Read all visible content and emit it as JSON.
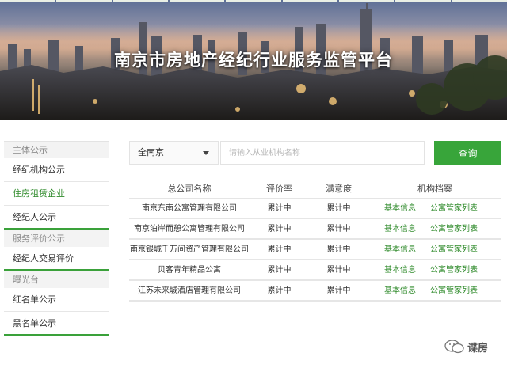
{
  "hero": {
    "title": "南京市房地产经纪行业服务监管平台"
  },
  "sidebar": {
    "groups": [
      {
        "label": "主体公示",
        "items": [
          {
            "label": "经纪机构公示"
          },
          {
            "label": "住房租赁企业",
            "active": true
          },
          {
            "label": "经纪人公示"
          }
        ]
      },
      {
        "label": "服务评价公示",
        "items": [
          {
            "label": "经纪人交易评价"
          }
        ]
      },
      {
        "label": "曝光台",
        "items": [
          {
            "label": "红名单公示"
          },
          {
            "label": "黑名单公示"
          }
        ]
      }
    ]
  },
  "search": {
    "scope_value": "全南京",
    "placeholder": "请输入从业机构名称",
    "button_label": "查询"
  },
  "table": {
    "headers": [
      "总公司名称",
      "评价率",
      "满意度",
      "机构档案"
    ],
    "rows": [
      {
        "name": "南京东南公寓管理有限公司",
        "rate": "累计中",
        "satisfaction": "累计中",
        "link1": "基本信息",
        "link2": "公寓管家列表"
      },
      {
        "name": "南京泊岸而憩公寓管理有限公司",
        "rate": "累计中",
        "satisfaction": "累计中",
        "link1": "基本信息",
        "link2": "公寓管家列表"
      },
      {
        "name": "南京银城千万间资产管理有限公司",
        "rate": "累计中",
        "satisfaction": "累计中",
        "link1": "基本信息",
        "link2": "公寓管家列表"
      },
      {
        "name": "贝客青年精品公寓",
        "rate": "累计中",
        "satisfaction": "累计中",
        "link1": "基本信息",
        "link2": "公寓管家列表"
      },
      {
        "name": "江苏未来城酒店管理有限公司",
        "rate": "累计中",
        "satisfaction": "累计中",
        "link1": "基本信息",
        "link2": "公寓管家列表"
      }
    ]
  },
  "watermark": {
    "text": "谍房",
    "icon": "wechat-icon"
  },
  "colors": {
    "accent": "#38a53a",
    "link": "#2e8a2a"
  }
}
